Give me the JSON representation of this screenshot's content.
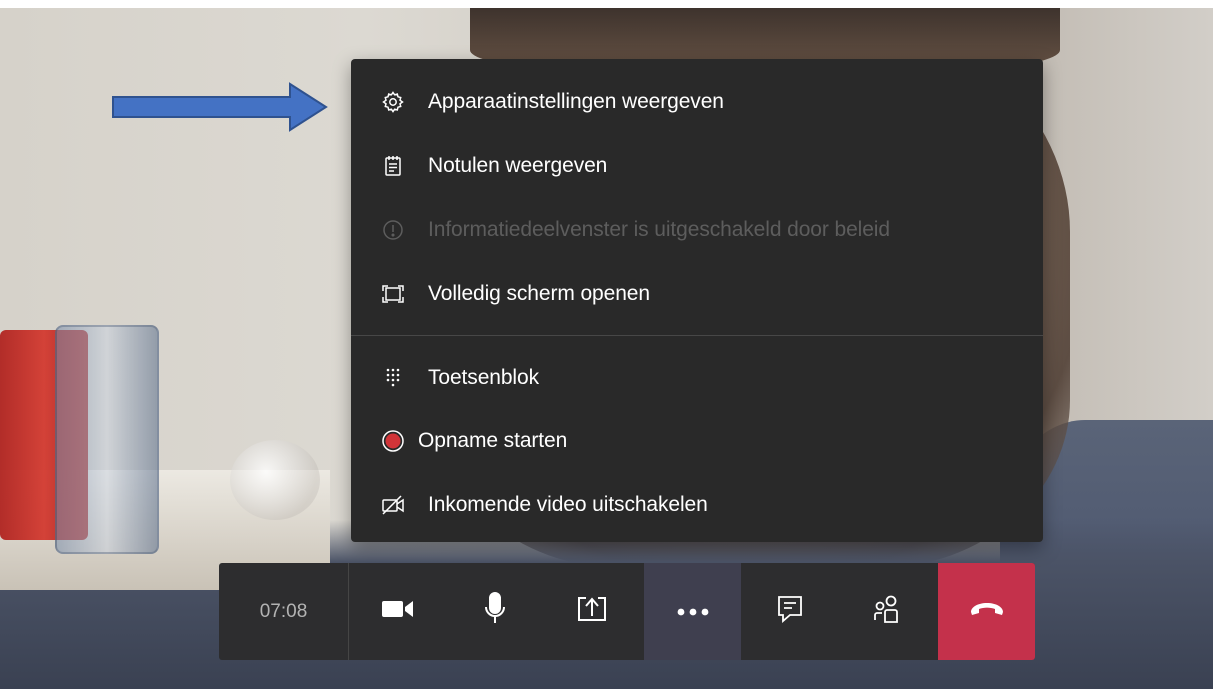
{
  "menu": {
    "items": [
      {
        "label": "Apparaatinstellingen weergeven",
        "icon": "gear-icon",
        "enabled": true
      },
      {
        "label": "Notulen weergeven",
        "icon": "notes-icon",
        "enabled": true
      },
      {
        "label": "Informatiedeelvenster is uitgeschakeld door beleid",
        "icon": "info-icon",
        "enabled": false
      },
      {
        "label": "Volledig scherm openen",
        "icon": "fullscreen-icon",
        "enabled": true
      },
      {
        "label": "Toetsenblok",
        "icon": "keypad-icon",
        "enabled": true
      },
      {
        "label": "Opname starten",
        "icon": "record-icon",
        "enabled": true
      },
      {
        "label": "Inkomende video uitschakelen",
        "icon": "video-off-icon",
        "enabled": true
      }
    ]
  },
  "callbar": {
    "timer": "07:08",
    "buttons": [
      {
        "name": "camera",
        "icon": "camera-icon"
      },
      {
        "name": "microphone",
        "icon": "microphone-icon"
      },
      {
        "name": "share",
        "icon": "share-screen-icon"
      },
      {
        "name": "more-actions",
        "icon": "more-icon",
        "active": true
      },
      {
        "name": "chat",
        "icon": "chat-icon"
      },
      {
        "name": "participants",
        "icon": "participants-icon"
      },
      {
        "name": "hang-up",
        "icon": "hang-up-icon"
      }
    ]
  },
  "colors": {
    "menu_bg": "#292929",
    "menu_text": "#ffffff",
    "menu_disabled_text": "#5d5d5d",
    "callbar_bg": "#2d2d2f",
    "active_button_bg": "#3f3f4f",
    "hangup_red": "#c4314b",
    "record_red": "#d13438",
    "annotation_arrow_blue": "#4472c4"
  }
}
